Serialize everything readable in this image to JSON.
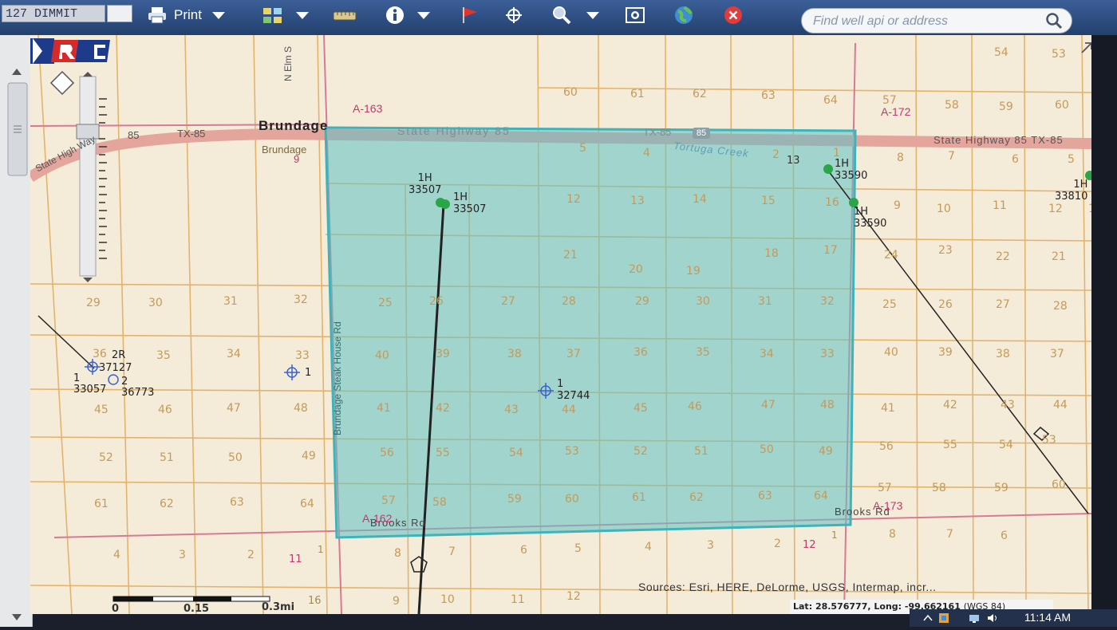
{
  "toolbar": {
    "county_value": "127 DIMMIT",
    "print_label": "Print",
    "search_placeholder": "Find well api or address",
    "icons": [
      "printer-icon",
      "grid-layers-icon",
      "measure-ruler-icon",
      "info-icon",
      "flag-icon",
      "crosshair-icon",
      "magnifier-icon",
      "zoom-extent-icon",
      "globe-icon",
      "close-icon",
      "search-icon"
    ]
  },
  "map": {
    "places": {
      "town": "Brundage",
      "town_small": "Brundage",
      "town_number": "9"
    },
    "roads": {
      "hwy_left_1": "TX-85",
      "hwy_left_2": "85",
      "hwy_left_3": "State High Way",
      "hwy_mid": "State Highway 85",
      "hwy_mid_tx": "TX-85",
      "hwy_shield": "85",
      "hwy_right": "State Highway 85 TX-85",
      "elm": "N Elm S",
      "steakhouse": "Brundage Steak House Rd",
      "brooks_left": "Brooks Rd",
      "brooks_right": "Brooks Rd"
    },
    "creek": "Tortuga Creek",
    "abstracts": [
      "A-163",
      "A-172",
      "A-162",
      "A-173"
    ],
    "wells": [
      {
        "num": "1H",
        "api": "33507"
      },
      {
        "num": "1H",
        "api": "33507"
      },
      {
        "num": "1H",
        "api": "33590"
      },
      {
        "num": "1H",
        "api": "33590"
      },
      {
        "num": "1H",
        "api": "33810"
      },
      {
        "num": "1",
        "api": "32744"
      },
      {
        "num": "1",
        "api": ""
      },
      {
        "num": "2R",
        "api": "37127"
      },
      {
        "num": "1",
        "api": "33057"
      },
      {
        "num": "2",
        "api": "36773"
      }
    ],
    "extra_numbers": [
      "13",
      "12",
      "11",
      "11",
      "16",
      "1",
      "1"
    ],
    "scalebar": [
      "0",
      "0.15",
      "0.3mi"
    ]
  },
  "footer": {
    "attribution": "Sources: Esri, HERE, DeLorme, USGS, Intermap, incr...",
    "coords_lat_label": "Lat:",
    "coords_lat": "28.576777,",
    "coords_long_label": "Long:",
    "coords_long": "-99.662161",
    "coords_datum": "(WGS 84)",
    "clock": "11:14 AM"
  },
  "colors": {
    "map_bg": "#f3ead6",
    "grid": "#e8b56d",
    "selection_fill": "#5fc1c4",
    "well_green": "#2aa648",
    "abstract_red": "#c2386d",
    "toolbar": "#2c4d82"
  }
}
